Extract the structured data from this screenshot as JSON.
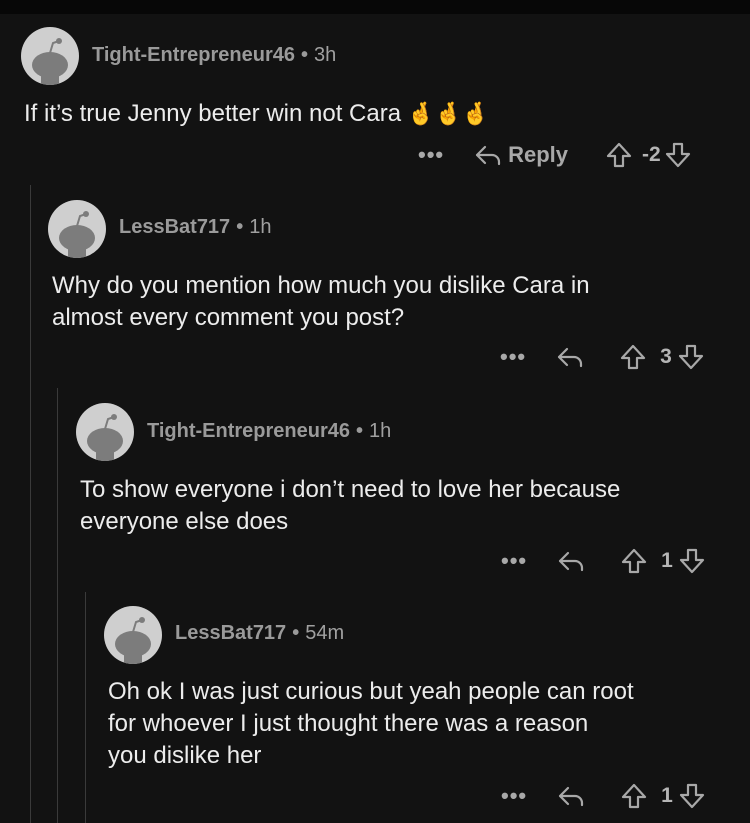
{
  "comments": [
    {
      "author": "Tight-Entrepreneur46",
      "time": "3h",
      "text_lines": [
        "If it’s true Jenny better win not Cara"
      ],
      "emoji": "🤞🤞🤞",
      "reply_label": "Reply",
      "score": "-2"
    },
    {
      "author": "LessBat717",
      "time": "1h",
      "text_lines": [
        "Why do you mention how much you dislike Cara in",
        "almost every comment you post?"
      ],
      "score": "3"
    },
    {
      "author": "Tight-Entrepreneur46",
      "time": "1h",
      "text_lines": [
        "To show everyone i don’t need to love her because",
        "everyone else does"
      ],
      "score": "1"
    },
    {
      "author": "LessBat717",
      "time": "54m",
      "text_lines": [
        "Oh ok I was just curious but yeah people can root",
        "for whoever I just thought there was a reason",
        "you dislike her"
      ],
      "score": "1"
    }
  ],
  "more_label": "•••",
  "separator": "•"
}
